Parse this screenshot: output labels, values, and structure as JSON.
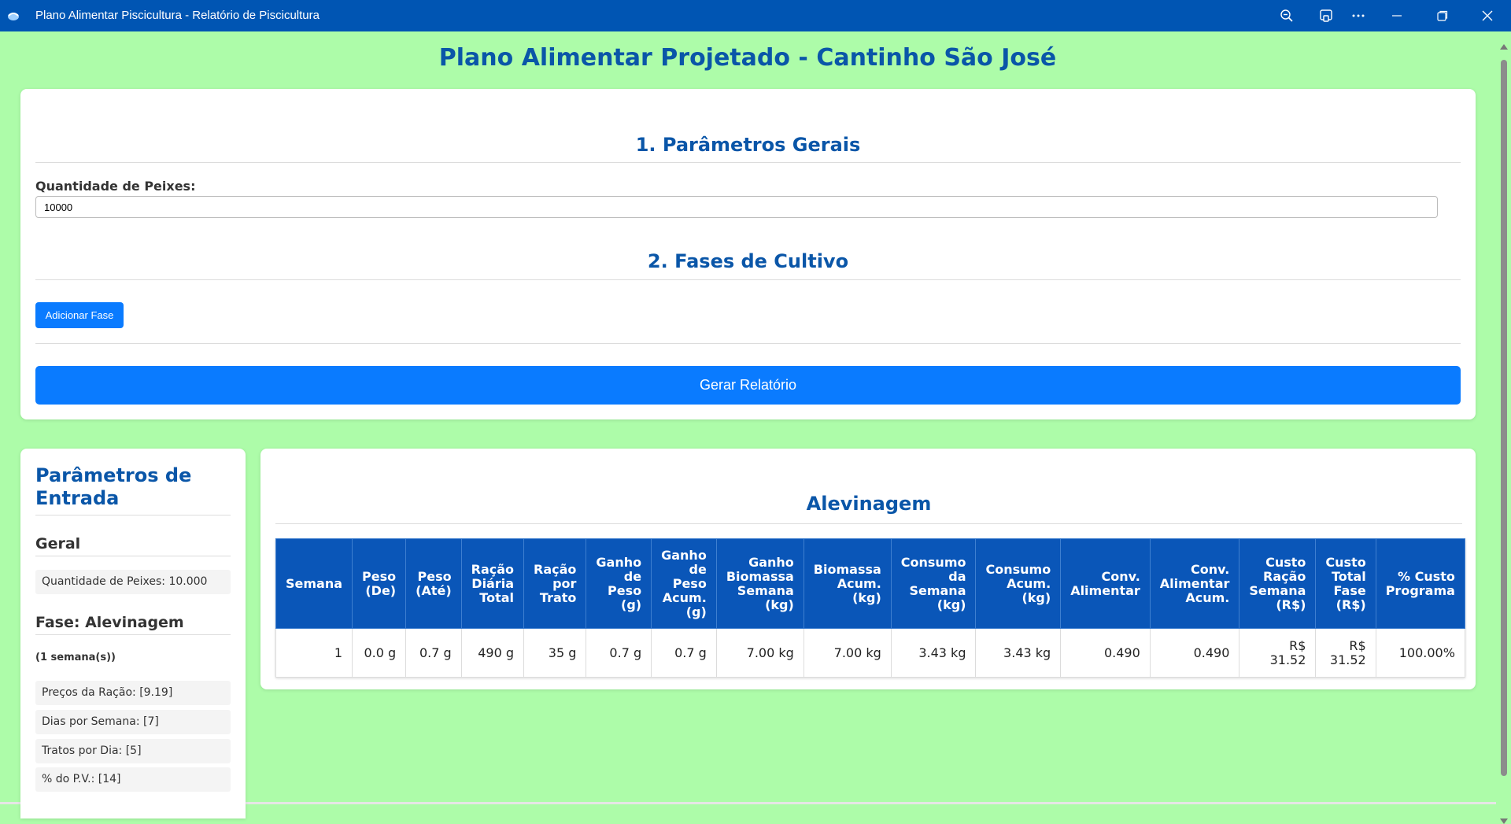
{
  "window": {
    "title": "Plano Alimentar Piscicultura - Relatório de Piscicultura"
  },
  "page": {
    "title": "Plano Alimentar Projetado - Cantinho São José"
  },
  "general": {
    "heading": "1. Parâmetros Gerais",
    "qty_label": "Quantidade de Peixes:",
    "qty_value": "10000"
  },
  "phases": {
    "heading": "2. Fases de Cultivo",
    "add_button": "Adicionar Fase"
  },
  "generate_button": "Gerar Relatório",
  "sidebar": {
    "title": "Parâmetros de Entrada",
    "general_heading": "Geral",
    "qty_item": "Quantidade de Peixes: 10.000",
    "phase_heading": "Fase: Alevinagem",
    "phase_duration": "(1 semana(s))",
    "items": [
      "Preços da Ração: [9.19]",
      "Dias por Semana: [7]",
      "Tratos por Dia: [5]",
      "% do P.V.: [14]"
    ]
  },
  "report": {
    "phase_title": "Alevinagem",
    "columns": [
      "Semana",
      "Peso (De)",
      "Peso (Até)",
      "Ração Diária Total",
      "Ração por Trato",
      "Ganho de Peso (g)",
      "Ganho de Peso Acum. (g)",
      "Ganho Biomassa Semana (kg)",
      "Biomassa Acum. (kg)",
      "Consumo da Semana (kg)",
      "Consumo Acum. (kg)",
      "Conv. Alimentar",
      "Conv. Alimentar Acum.",
      "Custo Ração Semana (R$)",
      "Custo Total Fase (R$)",
      "% Custo Programa"
    ],
    "rows": [
      [
        "1",
        "0.0 g",
        "0.7 g",
        "490 g",
        "35 g",
        "0.7 g",
        "0.7 g",
        "7.00 kg",
        "7.00 kg",
        "3.43 kg",
        "3.43 kg",
        "0.490",
        "0.490",
        "R$ 31.52",
        "R$ 31.52",
        "100.00%"
      ]
    ]
  },
  "colors": {
    "background": "#adfca9",
    "titlebar": "#0055b3",
    "heading": "#0a56a8",
    "button": "#0a7bff",
    "table_header": "#0a56b8"
  }
}
